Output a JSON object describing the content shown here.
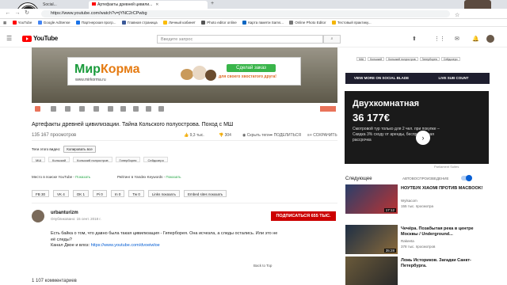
{
  "browser": {
    "tabs": [
      {
        "label": "Social..."
      },
      {
        "label": "Артефакты древней цивили..."
      }
    ],
    "url": "https://www.youtube.com/watch?v=jYNC2rCPwbg",
    "bookmarks": [
      {
        "label": "YouTube",
        "color": "#ff0000"
      },
      {
        "label": "Google AdSense",
        "color": "#4285f4"
      },
      {
        "label": "Партнерская прогр...",
        "color": "#1a73e8"
      },
      {
        "label": "Главная страница",
        "color": "#3b5998"
      },
      {
        "label": "Личный кабинет",
        "color": "#fbbc05"
      },
      {
        "label": "Photo editor online",
        "color": "#555555"
      },
      {
        "label": "Карта памяти Sams...",
        "color": "#0a66c2"
      },
      {
        "label": "Online Photo Editor",
        "color": "#777777"
      },
      {
        "label": "Тестовый практику...",
        "color": "#f4b400"
      }
    ]
  },
  "youtube": {
    "logo": "YouTube",
    "search_placeholder": "Введите запрос"
  },
  "ad_banner": {
    "brand_main": "Мир",
    "brand_accent": "Корма",
    "url": "www.mirkorma.ru",
    "order_button": "Сделай заказ",
    "tagline": "для своего хвостатого друга!"
  },
  "video": {
    "title": "Артефакты древней цивилизации. Тайна Кольского полуострова. Поход с МШ",
    "views": "135 167 просмотров",
    "likes": "9,3 тыс.",
    "dislikes": "304",
    "hide": "Скрыть теги",
    "share": "ПОДЕЛИТЬСЯ",
    "save": "СОХРАНИТЬ"
  },
  "tags_section": {
    "label": "Теги этого видео:",
    "copy_button": "Копировать все",
    "tags": [
      "МШ",
      "Кольский",
      "Кольский полуостров",
      "Гиперборея",
      "Сейдозеро"
    ]
  },
  "places": {
    "youtube_label": "Место в поиске YouTube - ",
    "youtube_link": "Показать",
    "yandex_label": "Рейтинг в Yandex Keywords - ",
    "yandex_link": "Показать"
  },
  "stats_chips": [
    "FB 30",
    "VK 4",
    "OK 1",
    "Pi 0",
    "In 0",
    "Tw 0",
    "Links показать",
    "Embed sites показать"
  ],
  "channel": {
    "name": "urbanturizm",
    "date": "Опубликовано: 15 сент. 2018 г.",
    "subscribe": "ПОДПИСАТЬСЯ  655 ТЫС."
  },
  "description": {
    "line1": "Есть байка о том, что давно была такая цивилизация - Гиперборея. Она исчезла, а следы остались. Или это не её следы?",
    "line2_prefix": "Канал Двое и влоз: ",
    "line2_link": "https://www.youtube.com/dvoeiwloe"
  },
  "back_to_top": "Back to Top",
  "comments_count": "1 107 комментариев",
  "sidebar": {
    "tags": [
      "МШ",
      "Кольский",
      "Кольский полуостров",
      "Гиперборея",
      "Сейдозеро"
    ],
    "social_blade": "VIEW MORE ON SOCIAL BLADE",
    "live_sub": "LIVE SUB COUNT",
    "ad": {
      "line1": "Двухкомнатная",
      "line2": "36 177€",
      "desc": "Смотровой тур только для 2 чел. при покупке – Скидка 3% сходу от аренды, беспроцентная рассрочка",
      "credit": "Parliament Suites"
    },
    "next_label": "Следующее",
    "autoplay_label": "АВТОВОСПРОИЗВЕДЕНИЕ",
    "videos": [
      {
        "title": "НОУТБУК XIAOMI ПРОТИВ MACBOOK!",
        "channel": "Wylsacom",
        "views": "155 тыс. просмотра",
        "duration": "17:12"
      },
      {
        "title": "Чечёра. Позабытая река в центре Москвы / Underground...",
        "channel": "Rakeeta",
        "views": "378 тыс. просмотров",
        "duration": "35:28"
      },
      {
        "title": "Ложь Историков. Загадки Санкт-Петербурга.",
        "channel": "",
        "views": "",
        "duration": ""
      }
    ]
  }
}
